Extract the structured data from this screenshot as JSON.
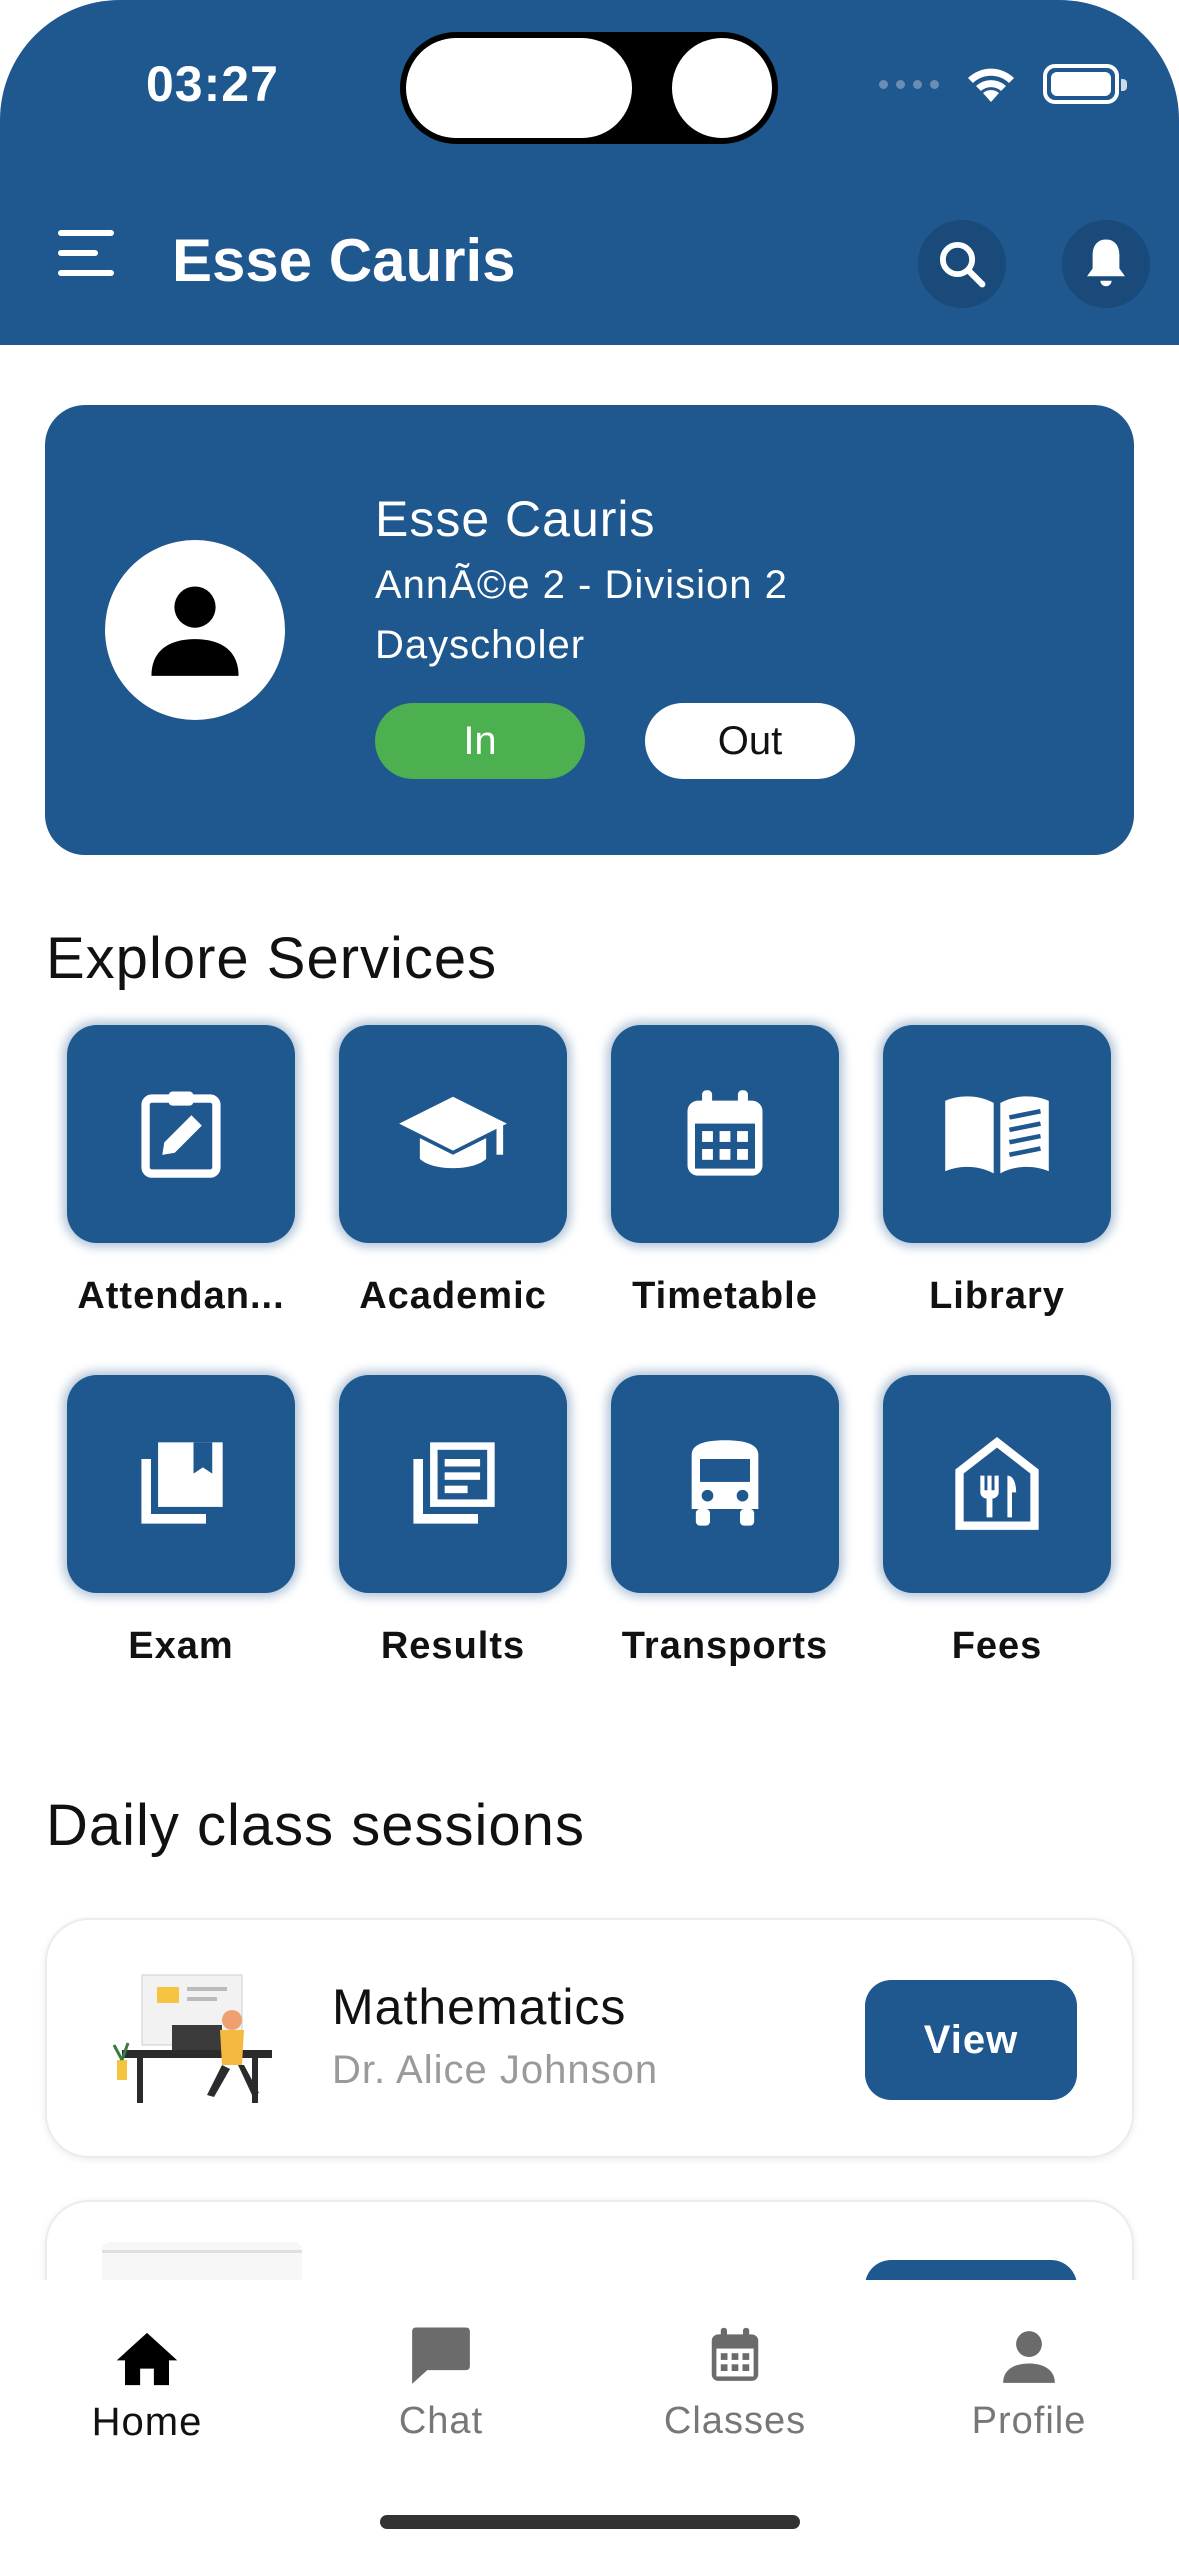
{
  "status_bar": {
    "time": "03:27"
  },
  "header": {
    "title": "Esse Cauris"
  },
  "profile": {
    "name": "Esse Cauris",
    "class": "AnnÃ©e 2 - Division 2",
    "type": "Dayscholer",
    "in_label": "In",
    "out_label": "Out"
  },
  "services": {
    "title": "Explore Services",
    "items": [
      {
        "label": "Attendan...",
        "icon": "clipboard-edit-icon"
      },
      {
        "label": "Academic",
        "icon": "graduation-cap-icon"
      },
      {
        "label": "Timetable",
        "icon": "calendar-icon"
      },
      {
        "label": "Library",
        "icon": "open-book-icon"
      },
      {
        "label": "Exam",
        "icon": "bookmark-stack-icon"
      },
      {
        "label": "Results",
        "icon": "documents-icon"
      },
      {
        "label": "Transports",
        "icon": "bus-icon"
      },
      {
        "label": "Fees",
        "icon": "restaurant-house-icon"
      }
    ]
  },
  "sessions": {
    "title": "Daily class sessions",
    "items": [
      {
        "subject": "Mathematics",
        "teacher": "Dr. Alice Johnson",
        "view_label": "View"
      }
    ]
  },
  "bottom_nav": {
    "items": [
      {
        "label": "Home",
        "icon": "home-icon"
      },
      {
        "label": "Chat",
        "icon": "chat-icon"
      },
      {
        "label": "Classes",
        "icon": "calendar-icon"
      },
      {
        "label": "Profile",
        "icon": "person-icon"
      }
    ]
  },
  "colors": {
    "primary": "#1f578f",
    "in_button": "#4caf50"
  }
}
